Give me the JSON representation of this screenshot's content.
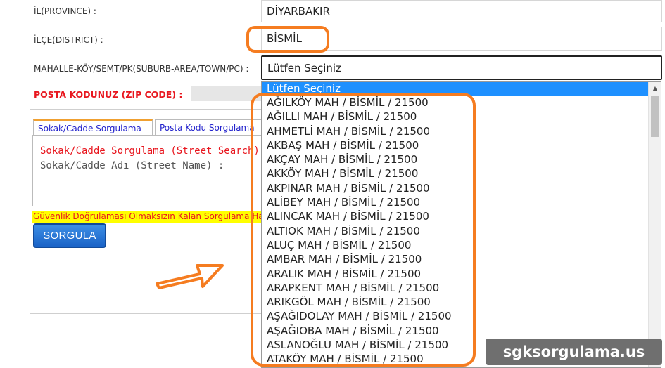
{
  "form": {
    "province_label": "İL(PROVINCE) :",
    "province_value": "DİYARBAKIR",
    "district_label": "İLÇE(DISTRICT) :",
    "district_value": "BİSMİL",
    "neighborhood_label": "MAHALLE-KÖY/SEMT/PK(SUBURB-AREA/TOWN/PC) :",
    "neighborhood_value": "Lütfen Seçiniz",
    "zip_label": "POSTA KODUNUZ (ZIP CODE) :"
  },
  "tabs": [
    {
      "label": "Sokak/Cadde Sorgulama"
    },
    {
      "label": "Posta Kodu Sorgulama"
    }
  ],
  "panel": {
    "title": "Sokak/Cadde Sorgulama (Street Search)",
    "street_label": "Sokak/Cadde Adı (Street Name) :"
  },
  "warning": "Güvenlik Doğrulaması Olmaksızın Kalan Sorgulama Hakkınız",
  "query_button": "SORGULA",
  "dropdown": {
    "selected": "Lütfen Seçiniz",
    "options": [
      "AĞILKÖY MAH / BİSMİL / 21500",
      "AĞILLI MAH / BİSMİL / 21500",
      "AHMETLİ MAH / BİSMİL / 21500",
      "AKBAŞ MAH / BİSMİL / 21500",
      "AKÇAY MAH / BİSMİL / 21500",
      "AKKÖY MAH / BİSMİL / 21500",
      "AKPINAR MAH / BİSMİL / 21500",
      "ALİBEY MAH / BİSMİL / 21500",
      "ALINCAK MAH / BİSMİL / 21500",
      "ALTIOK MAH / BİSMİL / 21500",
      "ALUÇ MAH / BİSMİL / 21500",
      "AMBAR MAH / BİSMİL / 21500",
      "ARALIK MAH / BİSMİL / 21500",
      "ARAPKENT MAH / BİSMİL / 21500",
      "ARIKGÖL MAH / BİSMİL / 21500",
      "AŞAĞIDOLAY MAH / BİSMİL / 21500",
      "AŞAĞIOBA MAH / BİSMİL / 21500",
      "ASLANOĞLU MAH / BİSMİL / 21500",
      "ATAKÖY MAH / BİSMİL / 21500"
    ]
  },
  "watermark": "sgksorgulama.us",
  "colors": {
    "highlight": "#f57c20",
    "selection": "#1e90ff",
    "zip_label": "#e8161e",
    "warning_bg": "#ffff00",
    "button": "#1a63c7"
  },
  "icons": {
    "arrow": "outline-arrow-icon",
    "scroll_up": "chevron-up-icon"
  }
}
